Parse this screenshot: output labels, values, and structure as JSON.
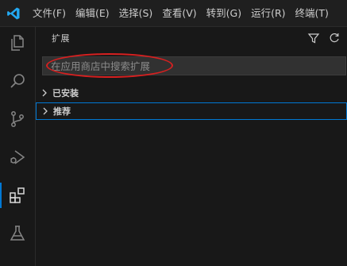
{
  "menu": [
    "文件(F)",
    "编辑(E)",
    "选择(S)",
    "查看(V)",
    "转到(G)",
    "运行(R)",
    "终端(T)"
  ],
  "activity_bar": {
    "items": [
      "explorer-icon",
      "search-icon",
      "source-control-icon",
      "run-debug-icon",
      "extensions-icon",
      "testing-icon"
    ],
    "active": "extensions-icon"
  },
  "sidebar": {
    "title": "扩展",
    "actions": [
      "filter-icon",
      "refresh-icon"
    ],
    "search": {
      "placeholder": "在应用商店中搜索扩展",
      "value": ""
    },
    "sections": [
      {
        "label": "已安装",
        "expanded": false
      },
      {
        "label": "推荐",
        "expanded": false,
        "focused": true
      }
    ]
  },
  "colors": {
    "accent": "#0078d4",
    "annotation": "#d62020",
    "brand": "#23a9f2"
  }
}
